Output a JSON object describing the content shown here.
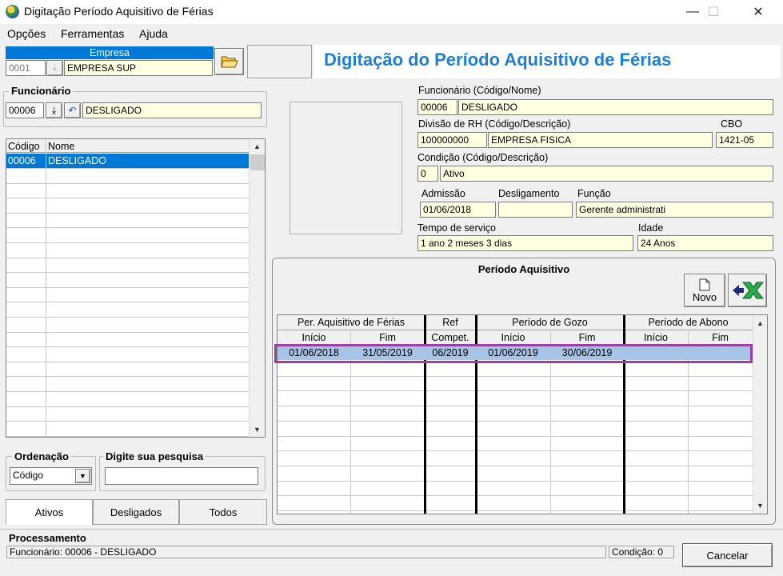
{
  "window": {
    "title": "Digitação Período Aquisitivo de Férias",
    "min": "—",
    "max": "☐",
    "close": "✕"
  },
  "menu": [
    "Opções",
    "Ferramentas",
    "Ajuda"
  ],
  "empresa": {
    "header": "Empresa",
    "code": "0001",
    "name": "EMPRESA SUP"
  },
  "banner": "Digitação do Período Aquisitivo de Férias",
  "funcionario_box": {
    "label": "Funcionário",
    "code": "00006",
    "name": "DESLIGADO"
  },
  "emp_list": {
    "columns": [
      "Código",
      "Nome"
    ],
    "rows": [
      {
        "code": "00006",
        "name": "DESLIGADO"
      }
    ]
  },
  "ordenacao": {
    "label": "Ordenação",
    "value": "Código"
  },
  "pesquisa": {
    "label": "Digite sua pesquisa",
    "value": ""
  },
  "tabs": [
    "Ativos",
    "Desligados",
    "Todos"
  ],
  "details": {
    "func_label": "Funcionário (Código/Nome)",
    "func_code": "00006",
    "func_name": "DESLIGADO",
    "div_label": "Divisão de RH (Código/Descrição)",
    "div_code": "100000000",
    "div_name": "EMPRESA FISICA",
    "cbo_label": "CBO",
    "cbo": "1421-05",
    "cond_label": "Condição (Código/Descrição)",
    "cond_code": "0",
    "cond_name": "Ativo",
    "adm_label": "Admissão",
    "adm": "01/06/2018",
    "desl_label": "Desligamento",
    "desl": "",
    "funcao_label": "Função",
    "funcao": "Gerente administrati",
    "tempo_label": "Tempo de serviço",
    "tempo": "1 ano 2 meses 3 dias",
    "idade_label": "Idade",
    "idade": "24 Anos"
  },
  "periodo": {
    "title": "Período Aquisitivo",
    "novo_label": "Novo",
    "groups": [
      "Per. Aquisitivo de Férias",
      "Ref",
      "Período de Gozo",
      "Período de Abono"
    ],
    "subcols": [
      "Início",
      "Fim",
      "Compet.",
      "Início",
      "Fim",
      "Início",
      "Fim"
    ],
    "rows": [
      [
        "01/06/2018",
        "31/05/2019",
        "06/2019",
        "01/06/2019",
        "30/06/2019",
        "",
        ""
      ]
    ]
  },
  "processamento": {
    "label": "Processamento",
    "status": "Funcionário: 00006 - DESLIGADO",
    "condicao": "Condição: 0",
    "cancel": "Cancelar"
  },
  "colors": {
    "banner": "#1e7fd6",
    "selection": "#0078d7",
    "highlight_border": "#9b3fa0",
    "empresa_header": "#0078d7"
  }
}
